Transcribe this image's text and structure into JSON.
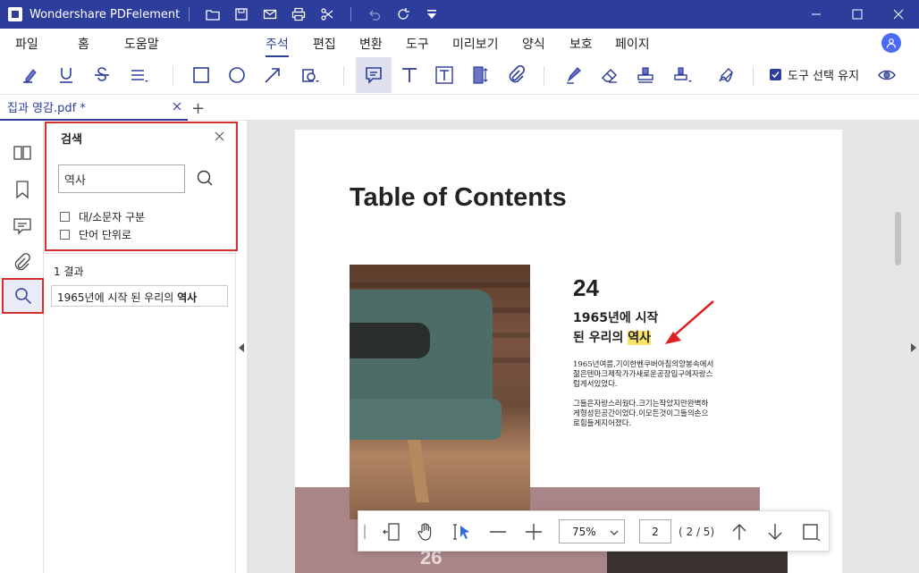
{
  "window": {
    "app_title": "Wondershare PDFelement",
    "quick_icons": [
      "folder-icon",
      "save-icon",
      "mail-icon",
      "print-icon",
      "scissors-icon",
      "undo-icon",
      "redo-icon",
      "dropdown-icon"
    ],
    "controls": [
      "minimize-icon",
      "maximize-icon",
      "close-icon"
    ],
    "accent_color": "#2d3d9c"
  },
  "menu": {
    "items": [
      "파일",
      "홈",
      "도움말",
      "주석",
      "편집",
      "변환",
      "도구",
      "미리보기",
      "양식",
      "보호",
      "페이지"
    ],
    "active": "주석"
  },
  "ribbon": {
    "tools": [
      "highlight-icon",
      "underline-icon",
      "strikethrough-icon",
      "text-lines-icon",
      "rectangle-icon",
      "circle-icon",
      "arrow-icon",
      "shape-icon",
      "sticky-note-icon",
      "text-icon",
      "textbox-icon",
      "callout-icon",
      "attachment-icon",
      "pencil-icon",
      "eraser-icon",
      "stamp-icon",
      "stamp-dropdown-icon",
      "signature-icon"
    ],
    "selected_tool": "sticky-note-icon",
    "keep_tool_label": "도구 선택 유지",
    "keep_tool_checked": true
  },
  "tabs": {
    "doc_tab_label": "집과 영감.pdf *",
    "add_label": "+"
  },
  "rail": {
    "items": [
      "thumbnails-icon",
      "bookmark-icon",
      "comment-icon",
      "attachment-icon",
      "search-icon"
    ],
    "active": "search-icon"
  },
  "search_panel": {
    "title": "검색",
    "query": "역사",
    "options": [
      {
        "label": "대/소문자 구분",
        "checked": false
      },
      {
        "label": "단어 단위로",
        "checked": false
      }
    ],
    "result_count": "1 결과",
    "result_prefix": "1965년에 시작 된 우리의 ",
    "result_match": "역사"
  },
  "document": {
    "heading": "Table of Contents",
    "article_number": "24",
    "article_title_line1": "1965년에 시작",
    "article_title_line2_prefix": "된 우리의 ",
    "article_title_highlight": "역사",
    "body_p1": "1965년여름,기이한벤쿠버아침의양봉속에서젊은텐마크제작가가새로운공장입구에자랑스럽게서있었다.",
    "body_p2": "그들은자랑스러웠다.크기는작았지만완벽하게형성된공간이었다.이모든것이그들의손으로힘들게지어졌다.",
    "band_number": "26",
    "highlight_color": "#fbe26b",
    "annotation_arrow_color": "#e02020"
  },
  "bottom_toolbar": {
    "tools": [
      "fit-page-icon",
      "hand-icon",
      "select-cursor-icon",
      "zoom-out-icon",
      "zoom-in-icon",
      "next-up-icon",
      "next-down-icon",
      "page-fit-icon"
    ],
    "zoom": "75%",
    "page_input": "2",
    "page_count": "( 2 / 5)"
  }
}
